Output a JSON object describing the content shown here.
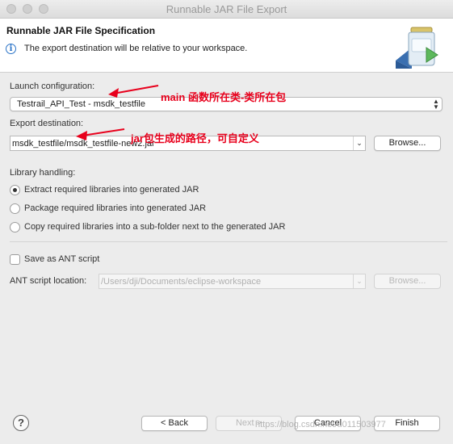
{
  "window": {
    "title": "Runnable JAR File Export"
  },
  "header": {
    "title": "Runnable JAR File Specification",
    "message": "The export destination will be relative to your workspace."
  },
  "launch": {
    "label": "Launch configuration:",
    "value": "Testrail_API_Test - msdk_testfile"
  },
  "export": {
    "label": "Export destination:",
    "value": "msdk_testfile/msdk_testfile-new2.jar",
    "browse_label": "Browse..."
  },
  "library": {
    "label": "Library handling:",
    "options": [
      "Extract required libraries into generated JAR",
      "Package required libraries into generated JAR",
      "Copy required libraries into a sub-folder next to the generated JAR"
    ],
    "selected_index": 0
  },
  "ant": {
    "checkbox_label": "Save as ANT script",
    "checked": false,
    "location_label": "ANT script location:",
    "location_value": "/Users/dji/Documents/eclipse-workspace",
    "browse_label": "Browse..."
  },
  "annotations": {
    "launch_note": "main 函数所在类-类所在包",
    "export_note": "jar包生成的路径，可自定义",
    "color": "#e8001c"
  },
  "footer": {
    "help_symbol": "?",
    "back_label": "< Back",
    "next_label": "Next >",
    "cancel_label": "Cancel",
    "finish_label": "Finish",
    "watermark": "https://blog.csdn.net/u011503977"
  },
  "icons": {
    "info": "info-icon",
    "help": "help-icon",
    "banner": "jar-export-wizard-icon"
  }
}
